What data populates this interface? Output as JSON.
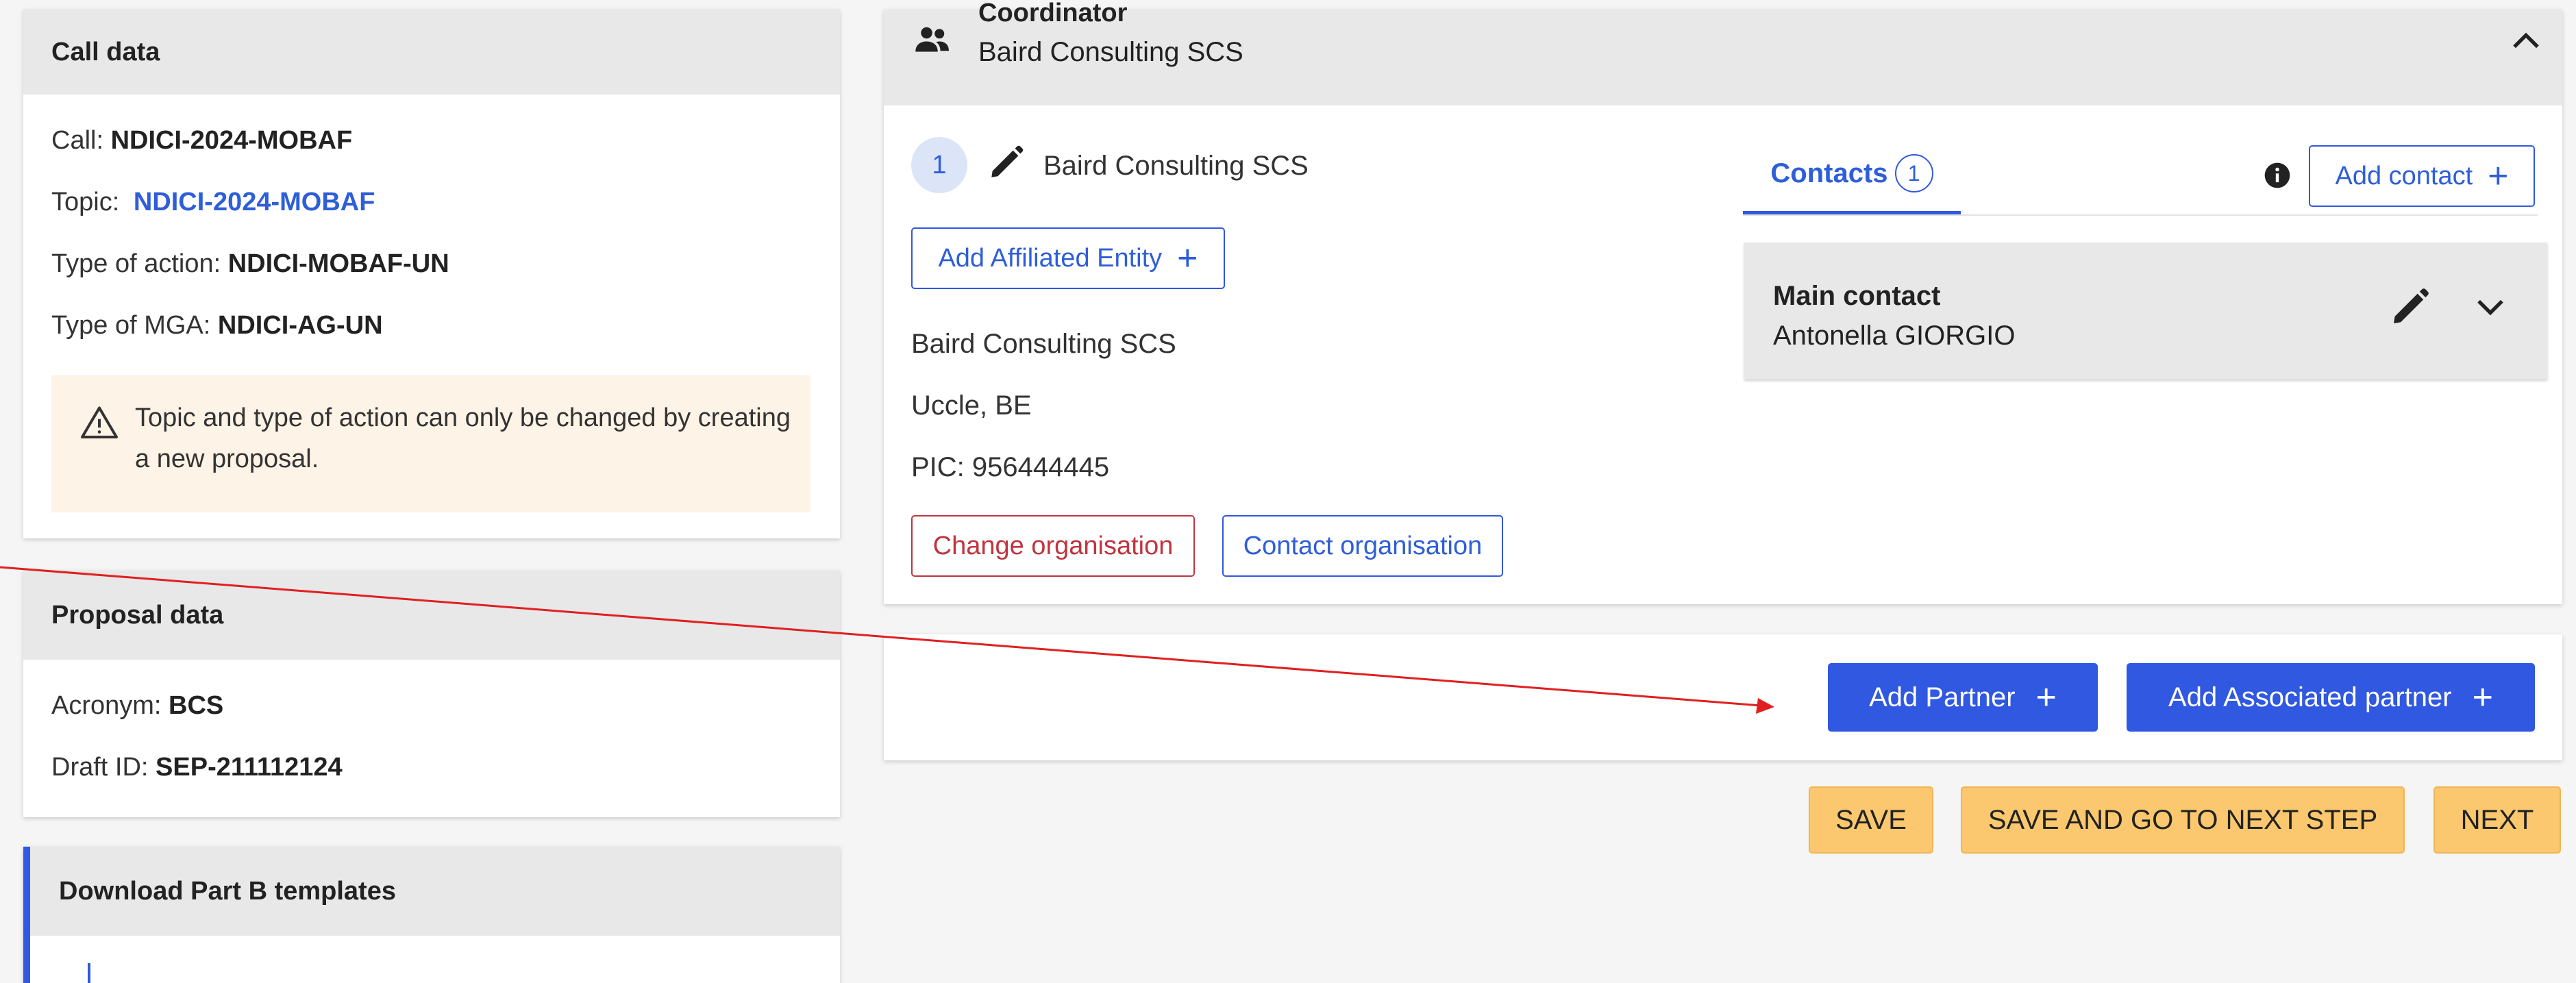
{
  "call_data": {
    "title": "Call data",
    "call_label": "Call:",
    "call_value": "NDICI-2024-MOBAF",
    "topic_label": "Topic:",
    "topic_value": "NDICI-2024-MOBAF",
    "type_of_action_label": "Type of action:",
    "type_of_action_value": "NDICI-MOBAF-UN",
    "type_of_mga_label": "Type of MGA:",
    "type_of_mga_value": "NDICI-AG-UN",
    "warning": "Topic and type of action can only be changed by creating a new proposal."
  },
  "proposal_data": {
    "title": "Proposal data",
    "acronym_label": "Acronym:",
    "acronym_value": "BCS",
    "draft_id_label": "Draft ID:",
    "draft_id_value": "SEP-211112124"
  },
  "download": {
    "title": "Download Part B templates"
  },
  "coordinator": {
    "title": "Coordinator",
    "subtitle": "Baird Consulting SCS",
    "number": "1",
    "org_name": "Baird Consulting SCS",
    "add_affiliated_label": "Add Affiliated Entity",
    "org_legal_name": "Baird Consulting SCS",
    "location": "Uccle, BE",
    "pic": "PIC: 956444445",
    "change_org_label": "Change organisation",
    "contact_org_label": "Contact organisation",
    "contacts_tab_label": "Contacts",
    "contacts_count": "1",
    "add_contact_label": "Add contact",
    "main_contact_title": "Main contact",
    "main_contact_name": "Antonella GIORGIO"
  },
  "partners": {
    "add_partner_label": "Add Partner",
    "add_associated_label": "Add Associated partner"
  },
  "footer": {
    "save_label": "SAVE",
    "save_next_label": "SAVE AND GO TO NEXT STEP",
    "next_label": "NEXT"
  },
  "colors": {
    "primary": "#3058e0",
    "warning_bg": "#fdf3e6",
    "danger": "#c0343f",
    "yellow": "#fbc86f",
    "annotation_arrow": "#e02020"
  },
  "icons": {
    "people": "people-icon",
    "chevron_up": "chevron-up-icon",
    "pencil": "pencil-icon",
    "info": "info-icon",
    "chevron_down": "chevron-down-icon",
    "warning": "warning-icon",
    "plus": "plus-icon"
  }
}
